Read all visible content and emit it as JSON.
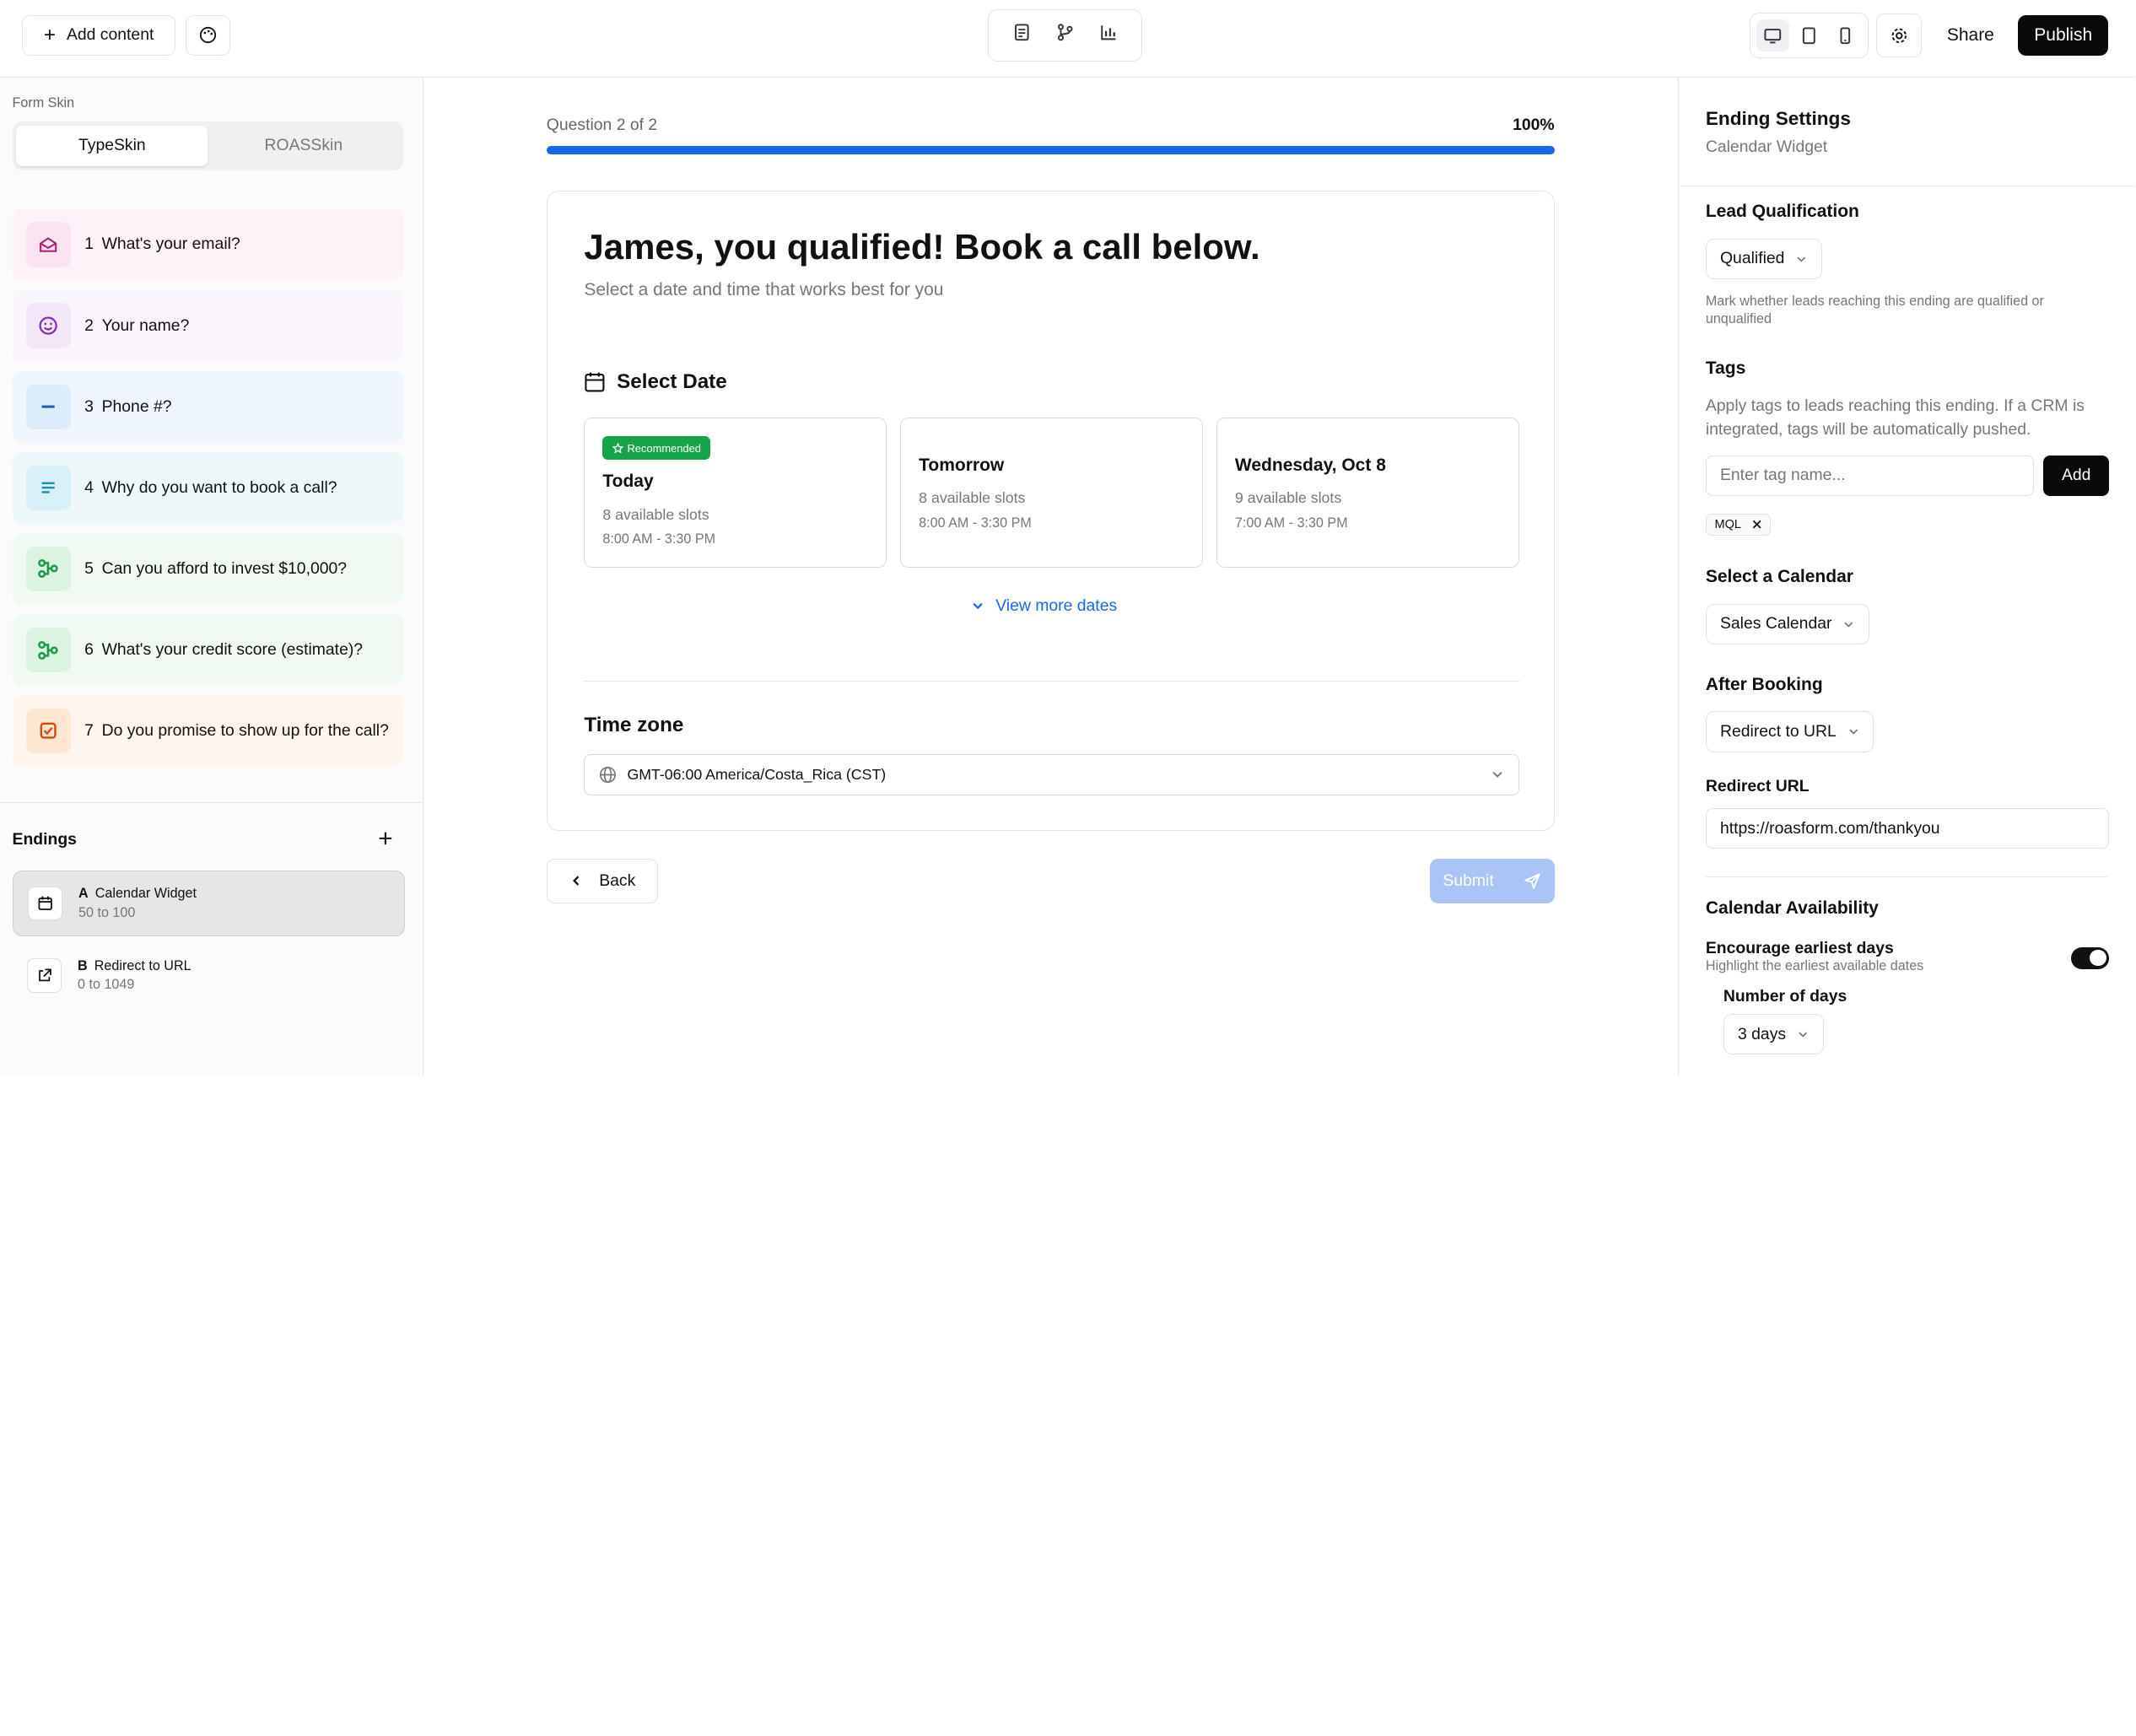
{
  "topbar": {
    "add_content_label": "Add content",
    "share_label": "Share",
    "publish_label": "Publish"
  },
  "sidebar": {
    "form_skin_label": "Form Skin",
    "skins": [
      "TypeSkin",
      "ROASSkin"
    ],
    "active_skin": "TypeSkin",
    "questions": [
      {
        "num": "1",
        "label": "What's your email?",
        "icon": "mail-open-icon",
        "bg": "#fdf2f8",
        "icon_bg": "#fbe4f1",
        "icon_color": "#b0237a"
      },
      {
        "num": "2",
        "label": "Your name?",
        "icon": "smiley-icon",
        "bg": "#faf5fc",
        "icon_bg": "#f2e6f7",
        "icon_color": "#8a2fb5"
      },
      {
        "num": "3",
        "label": "Phone #?",
        "icon": "minus-icon",
        "bg": "#eff6fd",
        "icon_bg": "#dcecfb",
        "icon_color": "#1f5fb8"
      },
      {
        "num": "4",
        "label": "Why do you want to book a call?",
        "icon": "text-lines-icon",
        "bg": "#eef8fb",
        "icon_bg": "#d8f0f7",
        "icon_color": "#1a8fb0"
      },
      {
        "num": "5",
        "label": "Can you afford to invest $10,000?",
        "icon": "branch-icon",
        "bg": "#f0faf2",
        "icon_bg": "#dcf3e2",
        "icon_color": "#1d9a47"
      },
      {
        "num": "6",
        "label": "What's your credit score (estimate)?",
        "icon": "branch-icon",
        "bg": "#f0faf2",
        "icon_bg": "#dcf3e2",
        "icon_color": "#1d9a47"
      },
      {
        "num": "7",
        "label": "Do you promise to show up for the call?",
        "icon": "checkbox-icon",
        "bg": "#fef6ee",
        "icon_bg": "#fde6d2",
        "icon_color": "#d9480f"
      }
    ],
    "endings_title": "Endings",
    "endings": [
      {
        "letter": "A",
        "title": "Calendar Widget",
        "range": "50 to 100",
        "icon": "calendar-icon"
      },
      {
        "letter": "B",
        "title": "Redirect to URL",
        "range": "0 to 1049",
        "icon": "external-link-icon"
      }
    ]
  },
  "main": {
    "progress_label": "Question 2 of 2",
    "progress_pct": "100%",
    "progress_value": 100,
    "heading": "James, you qualified! Book a call below.",
    "subheading": "Select a date and time that works best for you",
    "select_date_label": "Select Date",
    "recommended_badge": "Recommended",
    "dates": [
      {
        "title": "Today",
        "slots": "8 available slots",
        "hours": "8:00 AM - 3:30 PM"
      },
      {
        "title": "Tomorrow",
        "slots": "8 available slots",
        "hours": "8:00 AM - 3:30 PM"
      },
      {
        "title": "Wednesday, Oct 8",
        "slots": "9 available slots",
        "hours": "7:00 AM - 3:30 PM"
      }
    ],
    "view_more_label": "View more dates",
    "timezone_title": "Time zone",
    "timezone_value": "GMT-06:00 America/Costa_Rica (CST)",
    "back_label": "Back",
    "submit_label": "Submit"
  },
  "settings": {
    "title": "Ending Settings",
    "subtitle": "Calendar Widget",
    "lead_qual_title": "Lead Qualification",
    "lead_qual_value": "Qualified",
    "lead_qual_help": "Mark whether leads reaching this ending are qualified or unqualified",
    "tags_title": "Tags",
    "tags_help": "Apply tags to leads reaching this ending. If a CRM is integrated, tags will be automatically pushed.",
    "tag_placeholder": "Enter tag name...",
    "tag_add_label": "Add",
    "tags": [
      "MQL"
    ],
    "calendar_title": "Select a Calendar",
    "calendar_value": "Sales Calendar",
    "after_booking_title": "After Booking",
    "after_booking_value": "Redirect to URL",
    "redirect_url_label": "Redirect URL",
    "redirect_url_value": "https://roasform.com/thankyou",
    "availability_title": "Calendar Availability",
    "encourage_label": "Encourage earliest days",
    "encourage_help": "Highlight the earliest available dates",
    "encourage_on": true,
    "num_days_label": "Number of days",
    "num_days_value": "3 days"
  }
}
